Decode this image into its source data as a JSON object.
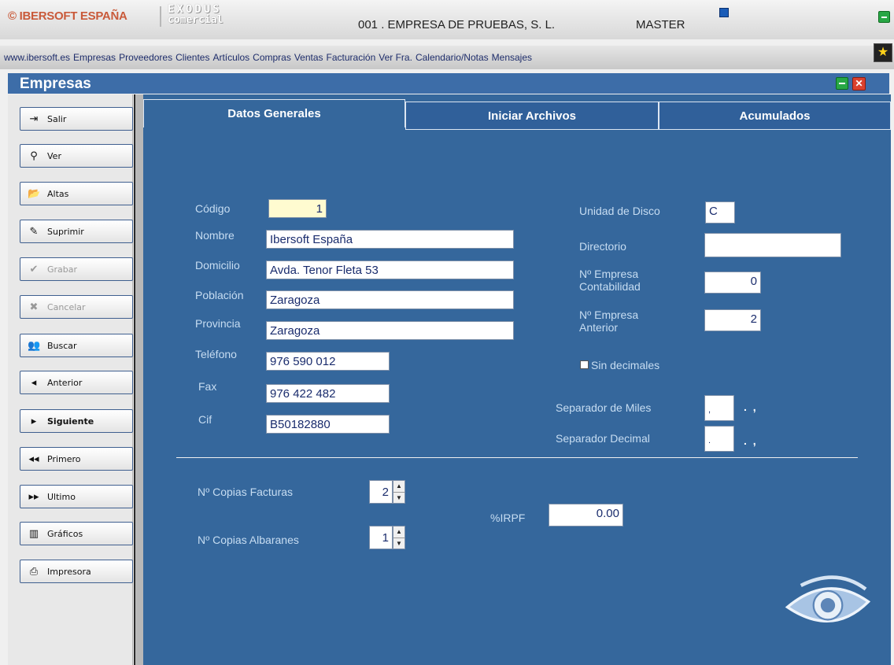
{
  "header": {
    "brand": "© IBERSOFT ESPAÑA",
    "product_line1": "EXODUS",
    "product_line2": "comercial",
    "company": "001 . EMPRESA DE PRUEBAS, S. L.",
    "user": "MASTER"
  },
  "menu": {
    "items": [
      "www.ibersoft.es",
      "Empresas",
      "Proveedores",
      "Clientes",
      "Artículos",
      "Compras",
      "Ventas",
      "Facturación",
      "Ver Fra.",
      "Calendario/Notas",
      "Mensajes"
    ]
  },
  "window": {
    "title": "Empresas",
    "close_glyph": "✕"
  },
  "sidebar": {
    "buttons": [
      {
        "label": "Salir",
        "icon": "exit-door-icon",
        "glyph": "⇥"
      },
      {
        "label": "Ver",
        "icon": "magnifier-icon",
        "glyph": "⚲"
      },
      {
        "label": "Altas",
        "icon": "open-folder-icon",
        "glyph": "📂"
      },
      {
        "label": "Suprimir",
        "icon": "eraser-icon",
        "glyph": "✎"
      },
      {
        "label": "Grabar",
        "icon": "checkmark-icon",
        "glyph": "✔"
      },
      {
        "label": "Cancelar",
        "icon": "cancel-x-icon",
        "glyph": "✖"
      },
      {
        "label": "Buscar",
        "icon": "people-search-icon",
        "glyph": "👥"
      },
      {
        "label": "Anterior",
        "icon": "arrow-left-icon",
        "glyph": "◂"
      },
      {
        "label": "Siguiente",
        "icon": "arrow-right-icon",
        "glyph": "▸"
      },
      {
        "label": "Primero",
        "icon": "double-arrow-left-icon",
        "glyph": "◂◂"
      },
      {
        "label": "Ultimo",
        "icon": "double-arrow-right-icon",
        "glyph": "▸▸"
      },
      {
        "label": "Gráficos",
        "icon": "bar-chart-icon",
        "glyph": "▥"
      },
      {
        "label": "Impresora",
        "icon": "printer-icon",
        "glyph": "⎙"
      }
    ]
  },
  "tabs": [
    {
      "label": "Datos Generales",
      "active": true
    },
    {
      "label": "Iniciar Archivos",
      "active": false
    },
    {
      "label": "Acumulados",
      "active": false
    }
  ],
  "form": {
    "codigo": {
      "label": "Código",
      "value": "1"
    },
    "nombre": {
      "label": "Nombre",
      "value": "Ibersoft España"
    },
    "domicilio": {
      "label": "Domicilio",
      "value": "Avda. Tenor Fleta 53"
    },
    "poblacion": {
      "label": "Población",
      "value": "Zaragoza"
    },
    "provincia": {
      "label": "Provincia",
      "value": "Zaragoza"
    },
    "telefono": {
      "label": "Teléfono",
      "value": "976 590 012"
    },
    "fax": {
      "label": "Fax",
      "value": "976 422 482"
    },
    "cif": {
      "label": "Cif",
      "value": "B50182880"
    },
    "unidad_disco": {
      "label": "Unidad de Disco",
      "value": "C"
    },
    "directorio": {
      "label": "Directorio",
      "value": ""
    },
    "empresa_contabilidad": {
      "label_line1": "Nº Empresa",
      "label_line2": "Contabilidad",
      "value": "0"
    },
    "empresa_anterior": {
      "label_line1": "Nº Empresa",
      "label_line2": "Anterior",
      "value": "2"
    },
    "sin_decimales": {
      "label": "Sin decimales",
      "checked": false
    },
    "separador_miles": {
      "label": "Separador de Miles",
      "value": ",",
      "hint": ". ,"
    },
    "separador_decimal": {
      "label": "Separador Decimal",
      "value": ".",
      "hint": ". ,"
    },
    "copias_facturas": {
      "label": "Nº Copias Facturas",
      "value": "2"
    },
    "copias_albaranes": {
      "label": "Nº Copias Albaranes",
      "value": "1"
    },
    "irpf": {
      "label": "%IRPF",
      "value": "0.00"
    }
  },
  "colors": {
    "panel_bg": "#35679c",
    "label_text": "#c7ddf2",
    "title_bar": "#3d6da8",
    "brand": "#c95a3a"
  }
}
